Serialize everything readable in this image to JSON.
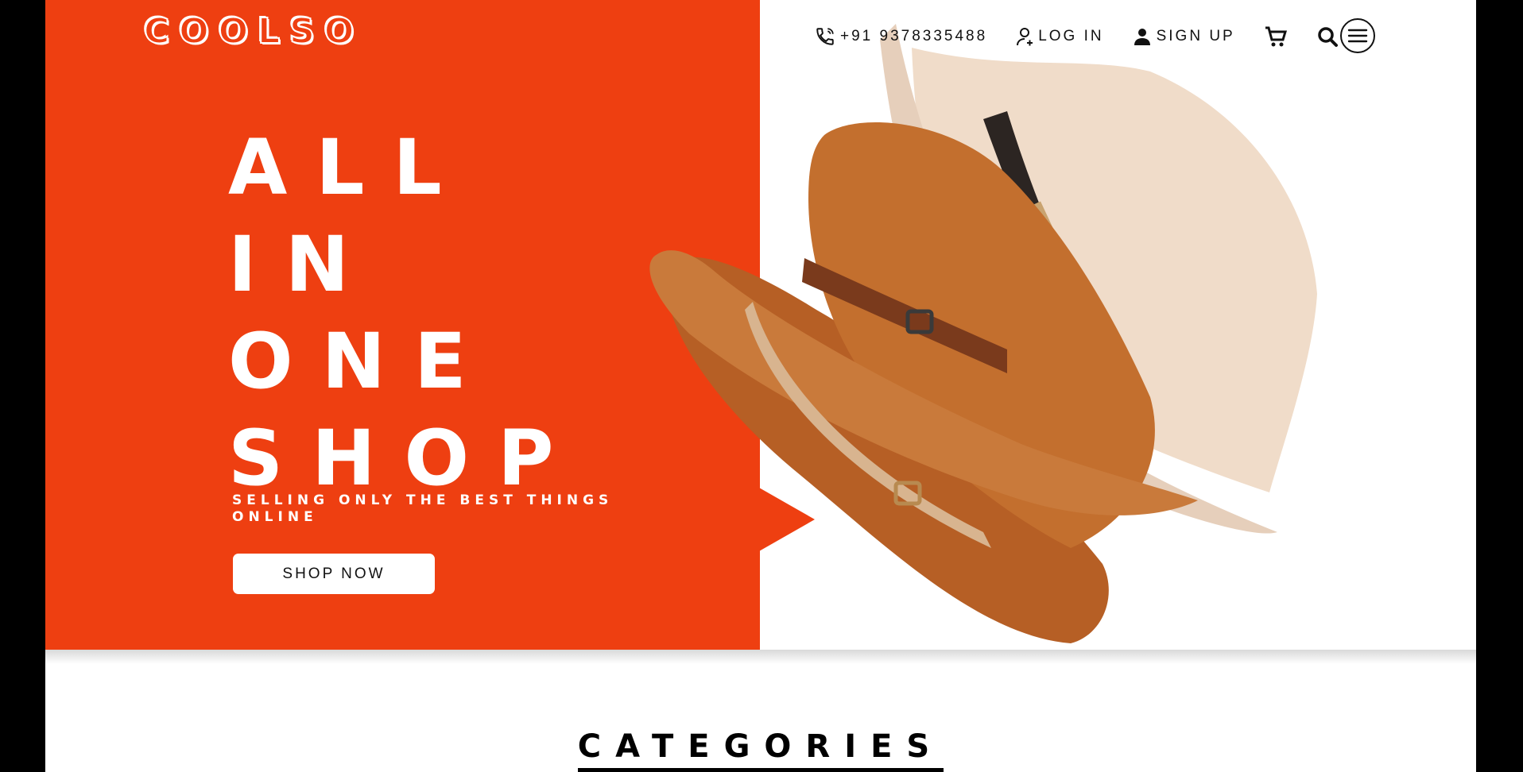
{
  "brand": {
    "logo_text": "COOLSO",
    "accent_color": "#ee3f11"
  },
  "nav": {
    "phone": "+91 9378335488",
    "login_label": "LOG IN",
    "signup_label": "SIGN UP",
    "icons": [
      "phone-icon",
      "login-user-icon",
      "signup-user-icon",
      "cart-icon",
      "search-icon",
      "hamburger-menu-icon"
    ]
  },
  "hero": {
    "headline_lines": [
      "ALL",
      "IN",
      "ONE",
      "SHOP"
    ],
    "tagline": "SELLING ONLY THE BEST THINGS ONLINE",
    "cta_label": "SHOP NOW",
    "image": "fedora-hats-image"
  },
  "categories": {
    "title": "CATEGORIES"
  }
}
